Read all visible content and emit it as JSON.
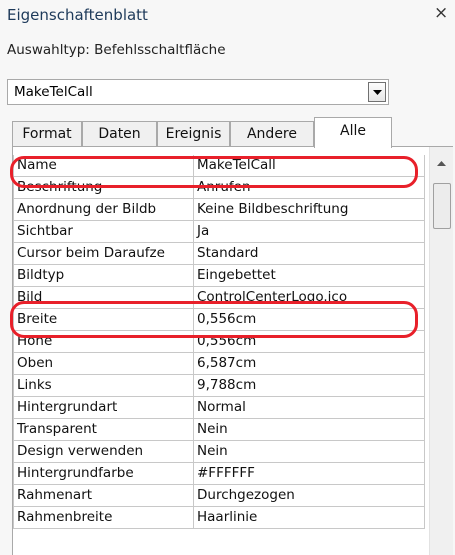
{
  "header": {
    "title": "Eigenschaftenblatt",
    "close_glyph": "×",
    "selection_type_label": "Auswahltyp:",
    "selection_type_value": "Befehlsschaltfläche"
  },
  "combo": {
    "value": "MakeTelCall",
    "button_icon": "chevron-down-icon"
  },
  "tabs": [
    {
      "label": "Format",
      "active": false
    },
    {
      "label": "Daten",
      "active": false
    },
    {
      "label": "Ereignis",
      "active": false
    },
    {
      "label": "Andere",
      "active": false
    },
    {
      "label": "Alle",
      "active": true
    }
  ],
  "properties": [
    {
      "name": "Name",
      "value": "MakeTelCall",
      "highlighted": true
    },
    {
      "name": "Beschriftung",
      "value": "Anrufen"
    },
    {
      "name": "Anordnung der Bildb",
      "value": "Keine Bildbeschriftung"
    },
    {
      "name": "Sichtbar",
      "value": "Ja"
    },
    {
      "name": "Cursor beim Daraufze",
      "value": "Standard"
    },
    {
      "name": "Bildtyp",
      "value": "Eingebettet"
    },
    {
      "name": "Bild",
      "value": "ControlCenterLogo.ico",
      "highlighted": true
    },
    {
      "name": "Breite",
      "value": "0,556cm"
    },
    {
      "name": "Höhe",
      "value": "0,556cm"
    },
    {
      "name": "Oben",
      "value": "6,587cm"
    },
    {
      "name": "Links",
      "value": "9,788cm"
    },
    {
      "name": "Hintergrundart",
      "value": "Normal"
    },
    {
      "name": "Transparent",
      "value": "Nein"
    },
    {
      "name": "Design verwenden",
      "value": "Nein"
    },
    {
      "name": "Hintergrundfarbe",
      "value": "#FFFFFF"
    },
    {
      "name": "Rahmenart",
      "value": "Durchgezogen"
    },
    {
      "name": "Rahmenbreite",
      "value": "Haarlinie"
    }
  ],
  "colors": {
    "highlight": "#e8202a",
    "title": "#1e3a5a"
  }
}
